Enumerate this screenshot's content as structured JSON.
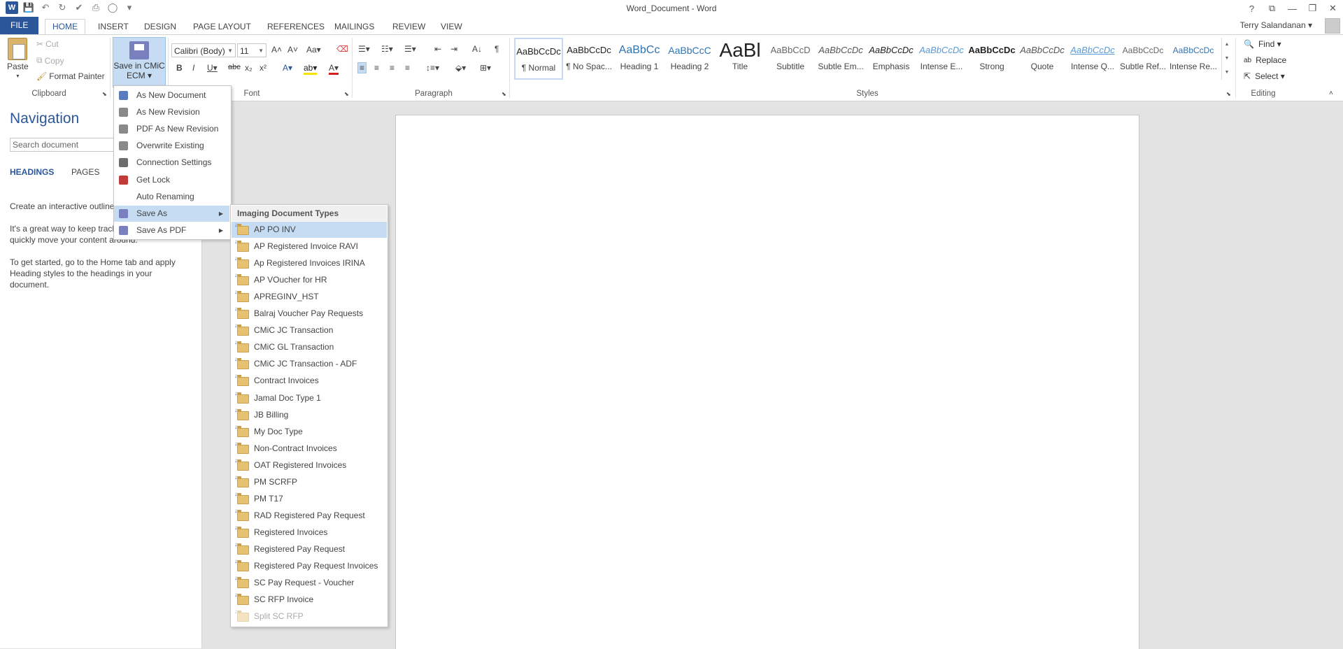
{
  "window": {
    "title": "Word_Document - Word",
    "controls": [
      "?",
      "⧉",
      "—",
      "❐",
      "✕"
    ]
  },
  "tabs": [
    "FILE",
    "HOME",
    "INSERT",
    "DESIGN",
    "PAGE LAYOUT",
    "REFERENCES",
    "MAILINGS",
    "REVIEW",
    "VIEW"
  ],
  "active_tab": "HOME",
  "user": {
    "name": "Terry Salandanan ▾"
  },
  "ribbon": {
    "clipboard": {
      "label": "Clipboard",
      "paste": "Paste",
      "cut": "Cut",
      "copy": "Copy",
      "format_painter": "Format Painter"
    },
    "save_cmic": {
      "line1": "Save in CMiC",
      "line2": "ECM ▾"
    },
    "font": {
      "label": "Font",
      "family": "Calibri (Body)",
      "size": "11"
    },
    "paragraph": {
      "label": "Paragraph"
    },
    "styles": {
      "label": "Styles",
      "items": [
        {
          "sample": "AaBbCcDc",
          "name": "¶ Normal",
          "color": "#222222"
        },
        {
          "sample": "AaBbCcDc",
          "name": "¶ No Spac...",
          "color": "#222222"
        },
        {
          "sample": "AaBbCc",
          "name": "Heading 1",
          "color": "#2e74b5"
        },
        {
          "sample": "AaBbCcC",
          "name": "Heading 2",
          "color": "#2e74b5"
        },
        {
          "sample": "AaBl",
          "name": "Title",
          "color": "#222222"
        },
        {
          "sample": "AaBbCcD",
          "name": "Subtitle",
          "color": "#666666"
        },
        {
          "sample": "AaBbCcDc",
          "name": "Subtle Em...",
          "color": "#555555"
        },
        {
          "sample": "AaBbCcDc",
          "name": "Emphasis",
          "color": "#333333"
        },
        {
          "sample": "AaBbCcDc",
          "name": "Intense E...",
          "color": "#5b9bd5"
        },
        {
          "sample": "AaBbCcDc",
          "name": "Strong",
          "color": "#111111"
        },
        {
          "sample": "AaBbCcDc",
          "name": "Quote",
          "color": "#555555"
        },
        {
          "sample": "AaBbCcDc",
          "name": "Intense Q...",
          "color": "#5b9bd5"
        },
        {
          "sample": "AaBbCcDc",
          "name": "Subtle Ref...",
          "color": "#666666"
        },
        {
          "sample": "AaBbCcDc",
          "name": "Intense Re...",
          "color": "#2e74b5"
        }
      ]
    },
    "editing": {
      "label": "Editing",
      "find": "Find ▾",
      "replace": "Replace",
      "select": "Select ▾"
    }
  },
  "navigation": {
    "title": "Navigation",
    "search_placeholder": "Search document",
    "tabs": [
      "HEADINGS",
      "PAGES"
    ],
    "text1a": "Create an interactive outline",
    "text2a": "It's a great way to keep track",
    "text2b": "quickly move your content around.",
    "text3": "To get started, go to the Home tab and apply Heading styles to the headings in your document."
  },
  "save_menu": {
    "items": [
      {
        "label": "As New Document",
        "icon_color": "#5b7bbf"
      },
      {
        "label": "As New Revision",
        "icon_color": "#8a8a8a"
      },
      {
        "label": "PDF As New Revision",
        "icon_color": "#8a8a8a"
      },
      {
        "label": "Overwrite Existing",
        "icon_color": "#8a8a8a"
      },
      {
        "label": "Connection Settings",
        "icon_color": "#6d6d6d"
      },
      {
        "label": "Get Lock",
        "icon_color": "#c23b3b"
      },
      {
        "label": "Auto Renaming",
        "icon_color": "#ffffff"
      },
      {
        "label": "Save As",
        "icon_color": "#7a7fbd",
        "submenu": true
      },
      {
        "label": "Save As PDF",
        "icon_color": "#7a7fbd",
        "submenu": true
      }
    ],
    "hover_index": 7
  },
  "save_as_submenu": {
    "header": "Imaging Document Types",
    "items": [
      "AP PO INV",
      "AP Registered Invoice RAVI",
      "Ap Registered Invoices IRINA",
      "AP VOucher for HR",
      "APREGINV_HST",
      "Balraj Voucher Pay Requests",
      "CMiC  JC Transaction",
      "CMiC GL Transaction",
      "CMiC JC Transaction - ADF",
      "Contract Invoices",
      "Jamal Doc Type 1",
      "JB Billing",
      "My Doc Type",
      "Non-Contract Invoices",
      "OAT Registered Invoices",
      "PM SCRFP",
      "PM T17",
      "RAD Registered Pay Request",
      "Registered Invoices",
      "Registered Pay Request",
      "Registered Pay Request Invoices",
      "SC Pay Request - Voucher",
      "SC RFP Invoice",
      "Split SC RFP"
    ],
    "hover_index": 0,
    "dim_index": 23
  },
  "colors": {
    "accent": "#2b579a",
    "hover": "#c5dcf3",
    "page_bg": "#e3e3e3"
  }
}
